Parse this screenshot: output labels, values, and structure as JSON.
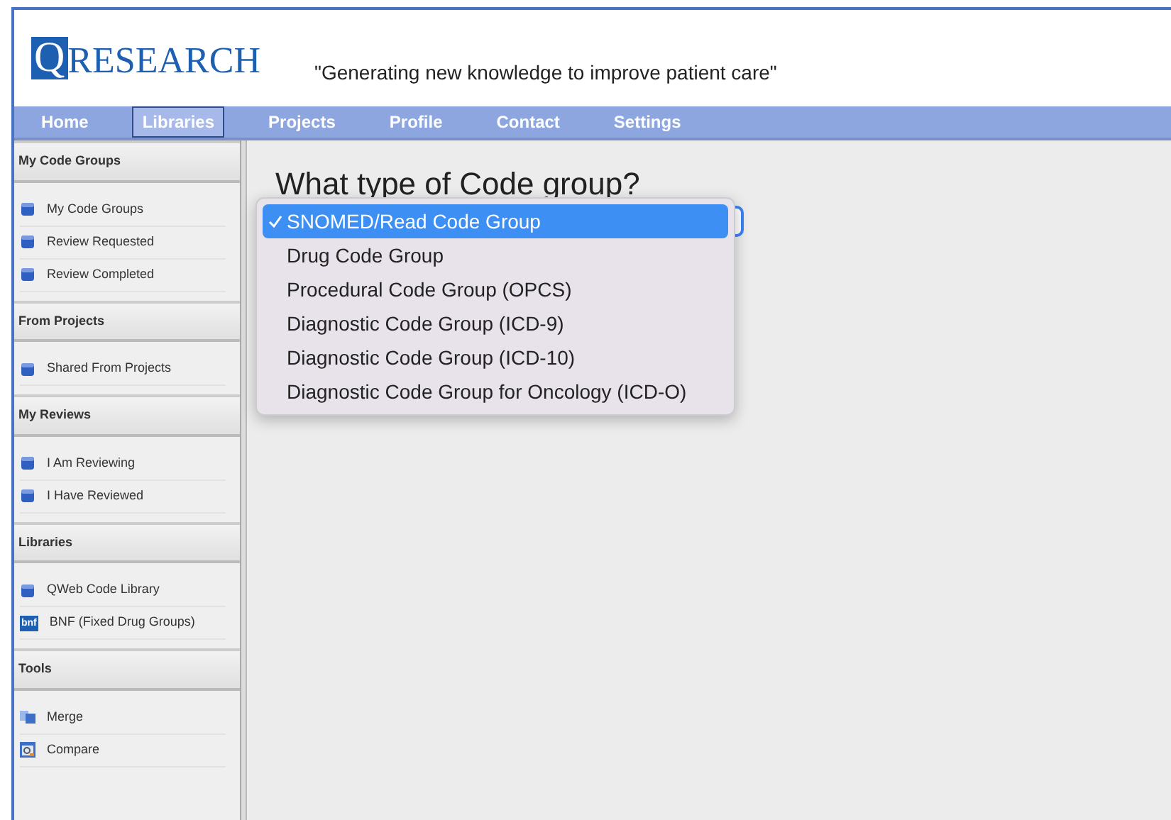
{
  "logo": {
    "initial": "Q",
    "word": "RESEARCH"
  },
  "tagline": "\"Generating new knowledge to improve patient care\"",
  "nav": [
    {
      "label": "Home",
      "selected": false
    },
    {
      "label": "Libraries",
      "selected": true
    },
    {
      "label": "Projects",
      "selected": false
    },
    {
      "label": "Profile",
      "selected": false
    },
    {
      "label": "Contact",
      "selected": false
    },
    {
      "label": "Settings",
      "selected": false
    }
  ],
  "sidebar": [
    {
      "title": "My Code Groups",
      "items": [
        {
          "label": "My Code Groups",
          "kind": "cube"
        },
        {
          "label": "Review Requested",
          "kind": "cube"
        },
        {
          "label": "Review Completed",
          "kind": "cube"
        }
      ]
    },
    {
      "title": "From Projects",
      "items": [
        {
          "label": "Shared From Projects",
          "kind": "cube"
        }
      ]
    },
    {
      "title": "My Reviews",
      "items": [
        {
          "label": "I Am Reviewing",
          "kind": "cube"
        },
        {
          "label": "I Have Reviewed",
          "kind": "cube"
        }
      ]
    },
    {
      "title": "Libraries",
      "items": [
        {
          "label": "QWeb Code Library",
          "kind": "cube"
        },
        {
          "label": "BNF (Fixed Drug Groups)",
          "kind": "bnf",
          "icon_text": "bnf"
        }
      ]
    },
    {
      "title": "Tools",
      "items": [
        {
          "label": "Merge",
          "kind": "merge"
        },
        {
          "label": "Compare",
          "kind": "compare"
        }
      ]
    }
  ],
  "heading": "What type of Code group?",
  "dropdown": [
    {
      "label": "SNOMED/Read Code Group",
      "selected": true
    },
    {
      "label": "Drug Code Group",
      "selected": false
    },
    {
      "label": "Procedural Code Group (OPCS)",
      "selected": false
    },
    {
      "label": "Diagnostic Code Group (ICD-9)",
      "selected": false
    },
    {
      "label": "Diagnostic Code Group (ICD-10)",
      "selected": false
    },
    {
      "label": "Diagnostic Code Group for Oncology (ICD-O)",
      "selected": false
    }
  ]
}
